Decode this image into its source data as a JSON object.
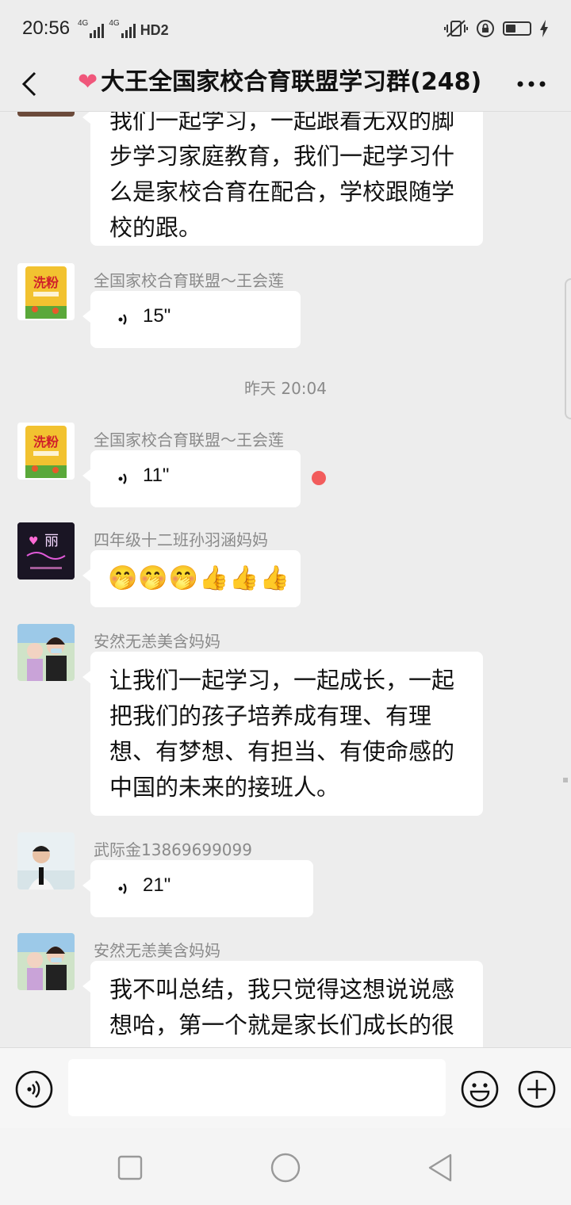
{
  "status_bar": {
    "time": "20:56",
    "net1": "4G",
    "net2": "4G",
    "hd": "HD2"
  },
  "header": {
    "title": "大王全国家校合育联盟学习群(248)",
    "heart_icon": "heart-icon",
    "back_icon": "chevron-left-icon",
    "more_icon": "more-dots-icon"
  },
  "messages": [
    {
      "type": "text",
      "text": "我们一起学习，一起跟着无双的脚步学习家庭教育，我们一起学习什么是家校合育在配合，学校跟随学校的跟。"
    },
    {
      "type": "voice",
      "sender": "全国家校合育联盟～王会莲",
      "duration": "15\""
    },
    {
      "type": "timestamp",
      "text": "昨天 20:04"
    },
    {
      "type": "voice",
      "sender": "全国家校合育联盟～王会莲",
      "duration": "11\"",
      "unread": true
    },
    {
      "type": "emoji",
      "sender": "四年级十二班孙羽涵妈妈",
      "emoji": "🤭🤭🤭👍👍👍"
    },
    {
      "type": "text",
      "sender": "安然无恙美含妈妈",
      "text": "让我们一起学习，一起成长，一起把我们的孩子培养成有理、有理想、有梦想、有担当、有使命感的中国的未来的接班人。"
    },
    {
      "type": "voice",
      "sender": "武际金13869699099",
      "duration": "21\""
    },
    {
      "type": "text",
      "sender": "安然无恙美含妈妈",
      "text": "我不叫总结，我只觉得这想说说感想哈，第一个就是家长们成长的很"
    }
  ],
  "avatars": {
    "rice_text": "洗粉",
    "neon_text": "丽"
  },
  "input_bar": {
    "voice_icon": "voice-mode-icon",
    "emoji_icon": "emoji-icon",
    "plus_icon": "plus-icon"
  },
  "nav_bar": {
    "icons": [
      "square-icon",
      "circle-icon",
      "back-triangle-icon"
    ]
  },
  "colors": {
    "background": "#ededed",
    "bubble": "#ffffff",
    "unread_dot": "#f25c5c",
    "heart": "#f0577b"
  }
}
